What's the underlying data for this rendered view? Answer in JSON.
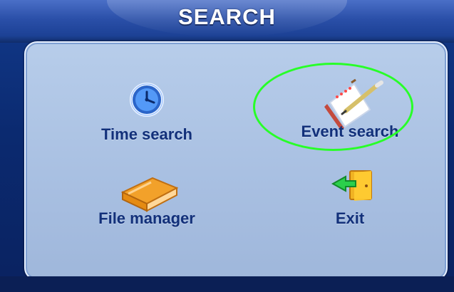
{
  "window": {
    "title": "SEARCH"
  },
  "menu": {
    "items": [
      {
        "label": "Time search",
        "icon": "clock-icon"
      },
      {
        "label": "Event search",
        "icon": "notebook-pen-icon",
        "highlighted": true
      },
      {
        "label": "File manager",
        "icon": "book-icon"
      },
      {
        "label": "Exit",
        "icon": "exit-door-icon"
      }
    ]
  },
  "colors": {
    "header": "#2a4fa8",
    "panel": "#b7cdea",
    "label_text": "#12307a",
    "highlight_ellipse": "#28ff28"
  }
}
